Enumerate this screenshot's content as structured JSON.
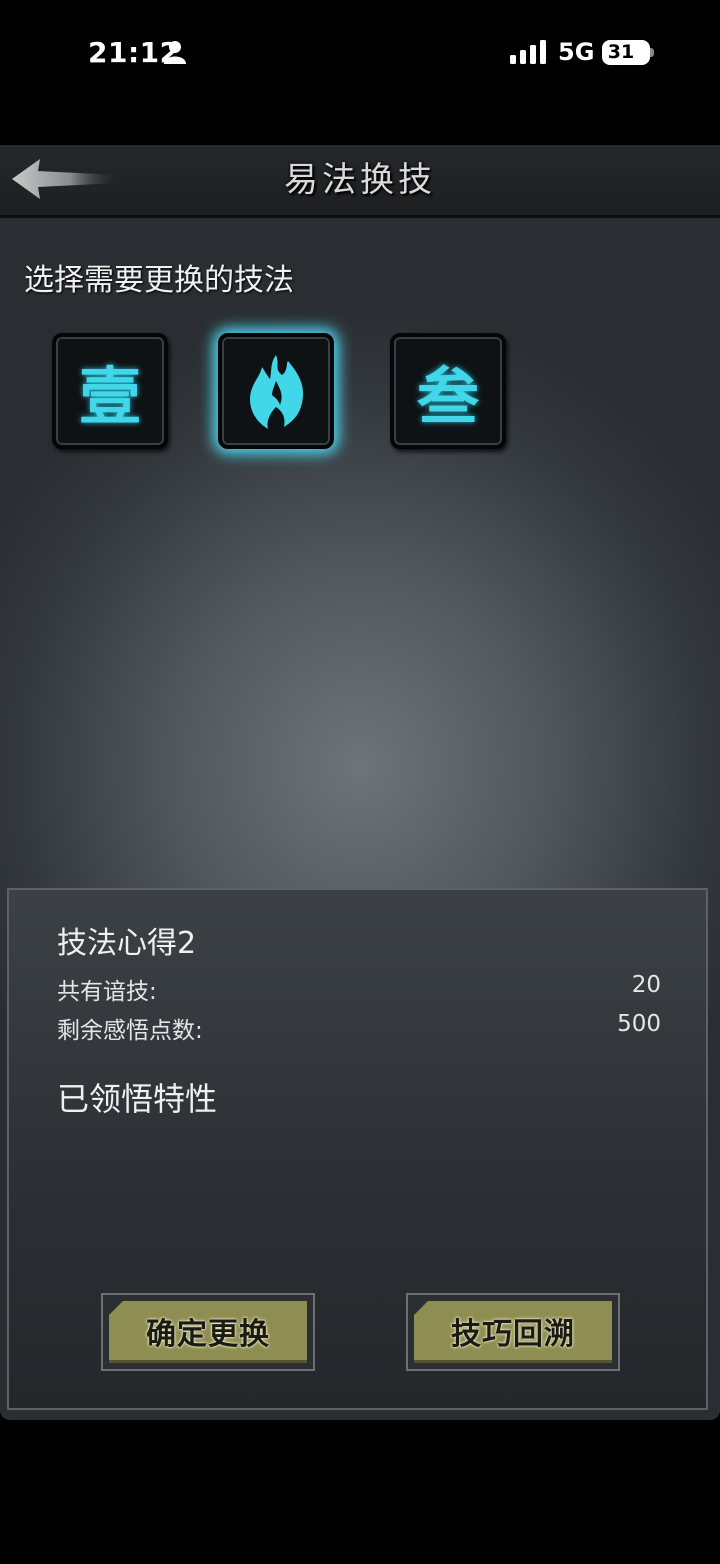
{
  "status_bar": {
    "time": "21:12",
    "network": "5G",
    "battery": "31"
  },
  "header": {
    "title": "易法换技"
  },
  "selection": {
    "prompt": "选择需要更换的技法",
    "slots": [
      {
        "label": "壹",
        "selected": false
      },
      {
        "label": "",
        "icon": "flame-icon",
        "selected": true
      },
      {
        "label": "叁",
        "selected": false
      }
    ],
    "glow_color": "#4fd8f0",
    "glyph_color": "#41d6e8"
  },
  "info": {
    "title": "技法心得2",
    "rows": [
      {
        "label": "共有谙技:",
        "value": "20"
      },
      {
        "label": "剩余感悟点数:",
        "value": "500"
      }
    ],
    "traits_heading": "已领悟特性"
  },
  "buttons": {
    "confirm": "确定更换",
    "rewind": "技巧回溯"
  }
}
